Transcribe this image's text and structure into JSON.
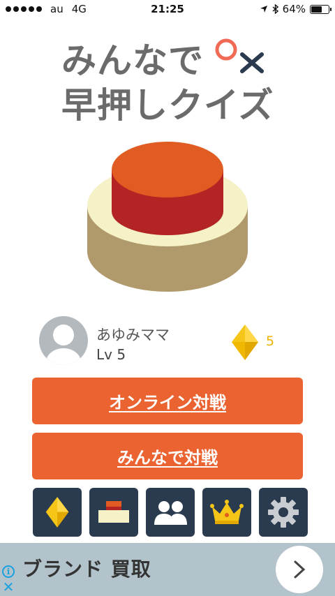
{
  "status_bar": {
    "carrier": "au",
    "network": "4G",
    "time": "21:25",
    "battery": "64%",
    "battery_level": 0.64
  },
  "title": {
    "line1": "みんなで",
    "line2": "早押しクイズ",
    "mark_colors": {
      "circle": "#f06a55",
      "cross": "#2a3a4f"
    }
  },
  "big_button": {
    "colors": {
      "top": "#e05c22",
      "side": "#b32525",
      "base_top": "#f6f2c8",
      "base_side": "#b09a6c"
    }
  },
  "profile": {
    "name": "あゆみママ",
    "level": "Lv 5",
    "gems": "5"
  },
  "buttons": {
    "online": "オンライン対戦",
    "together": "みんなで対戦"
  },
  "tiles": [
    {
      "icon": "gem-icon"
    },
    {
      "icon": "buzzer-icon"
    },
    {
      "icon": "users-icon"
    },
    {
      "icon": "crown-icon"
    },
    {
      "icon": "gear-icon"
    }
  ],
  "ad": {
    "text": "ブランド 買取",
    "info_glyph": "i",
    "close_glyph": "✕"
  },
  "colors": {
    "accent": "#ea6330",
    "tile_bg": "#2a3a4f",
    "gem": "#f5c518"
  }
}
